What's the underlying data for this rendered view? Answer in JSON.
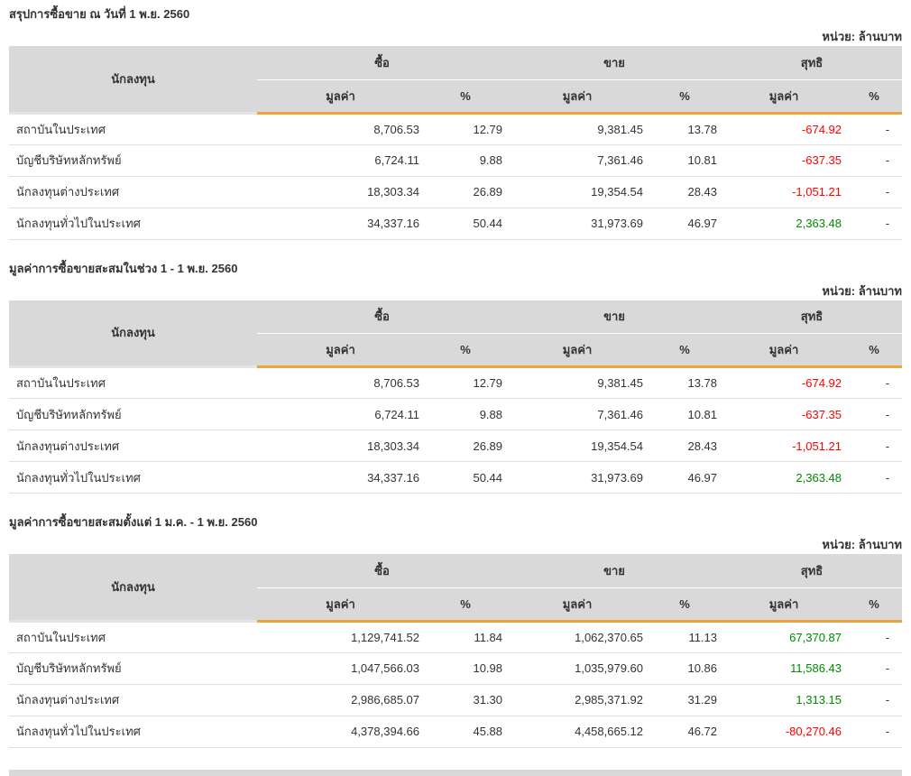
{
  "unit_label": "หน่วย: ล้านบาท",
  "columns": {
    "investor": "นักลงทุน",
    "buy": "ซื้อ",
    "sell": "ขาย",
    "net": "สุทธิ",
    "value": "มูลค่า",
    "percent": "%"
  },
  "colors": {
    "accent_orange": "#efa437",
    "header_bg": "#d9d9d9",
    "row_line": "#e0e0e0",
    "negative_red": "#ff0000",
    "positive_green": "#008a00",
    "text": "#333333"
  },
  "tables": [
    {
      "title": "สรุปการซื้อขาย ณ วันที่ 1 พ.ย. 2560",
      "rows": [
        {
          "investor": "สถาบันในประเทศ",
          "buy_value": "8,706.53",
          "buy_pct": "12.79",
          "sell_value": "9,381.45",
          "sell_pct": "13.78",
          "net_value": "-674.92",
          "net_trend": "negative",
          "net_pct": "-"
        },
        {
          "investor": "บัญชีบริษัทหลักทรัพย์",
          "buy_value": "6,724.11",
          "buy_pct": "9.88",
          "sell_value": "7,361.46",
          "sell_pct": "10.81",
          "net_value": "-637.35",
          "net_trend": "negative",
          "net_pct": "-"
        },
        {
          "investor": "นักลงทุนต่างประเทศ",
          "buy_value": "18,303.34",
          "buy_pct": "26.89",
          "sell_value": "19,354.54",
          "sell_pct": "28.43",
          "net_value": "-1,051.21",
          "net_trend": "negative",
          "net_pct": "-"
        },
        {
          "investor": "นักลงทุนทั่วไปในประเทศ",
          "buy_value": "34,337.16",
          "buy_pct": "50.44",
          "sell_value": "31,973.69",
          "sell_pct": "46.97",
          "net_value": "2,363.48",
          "net_trend": "positive",
          "net_pct": "-"
        }
      ]
    },
    {
      "title": "มูลค่าการซื้อขายสะสมในช่วง 1 - 1 พ.ย. 2560",
      "rows": [
        {
          "investor": "สถาบันในประเทศ",
          "buy_value": "8,706.53",
          "buy_pct": "12.79",
          "sell_value": "9,381.45",
          "sell_pct": "13.78",
          "net_value": "-674.92",
          "net_trend": "negative",
          "net_pct": "-"
        },
        {
          "investor": "บัญชีบริษัทหลักทรัพย์",
          "buy_value": "6,724.11",
          "buy_pct": "9.88",
          "sell_value": "7,361.46",
          "sell_pct": "10.81",
          "net_value": "-637.35",
          "net_trend": "negative",
          "net_pct": "-"
        },
        {
          "investor": "นักลงทุนต่างประเทศ",
          "buy_value": "18,303.34",
          "buy_pct": "26.89",
          "sell_value": "19,354.54",
          "sell_pct": "28.43",
          "net_value": "-1,051.21",
          "net_trend": "negative",
          "net_pct": "-"
        },
        {
          "investor": "นักลงทุนทั่วไปในประเทศ",
          "buy_value": "34,337.16",
          "buy_pct": "50.44",
          "sell_value": "31,973.69",
          "sell_pct": "46.97",
          "net_value": "2,363.48",
          "net_trend": "positive",
          "net_pct": "-"
        }
      ]
    },
    {
      "title": "มูลค่าการซื้อขายสะสมตั้งแต่ 1 ม.ค. - 1 พ.ย. 2560",
      "rows": [
        {
          "investor": "สถาบันในประเทศ",
          "buy_value": "1,129,741.52",
          "buy_pct": "11.84",
          "sell_value": "1,062,370.65",
          "sell_pct": "11.13",
          "net_value": "67,370.87",
          "net_trend": "positive",
          "net_pct": "-"
        },
        {
          "investor": "บัญชีบริษัทหลักทรัพย์",
          "buy_value": "1,047,566.03",
          "buy_pct": "10.98",
          "sell_value": "1,035,979.60",
          "sell_pct": "10.86",
          "net_value": "11,586.43",
          "net_trend": "positive",
          "net_pct": "-"
        },
        {
          "investor": "นักลงทุนต่างประเทศ",
          "buy_value": "2,986,685.07",
          "buy_pct": "31.30",
          "sell_value": "2,985,371.92",
          "sell_pct": "31.29",
          "net_value": "1,313.15",
          "net_trend": "positive",
          "net_pct": "-"
        },
        {
          "investor": "นักลงทุนทั่วไปในประเทศ",
          "buy_value": "4,378,394.66",
          "buy_pct": "45.88",
          "sell_value": "4,458,665.12",
          "sell_pct": "46.72",
          "net_value": "-80,270.46",
          "net_trend": "negative",
          "net_pct": "-"
        }
      ]
    }
  ]
}
